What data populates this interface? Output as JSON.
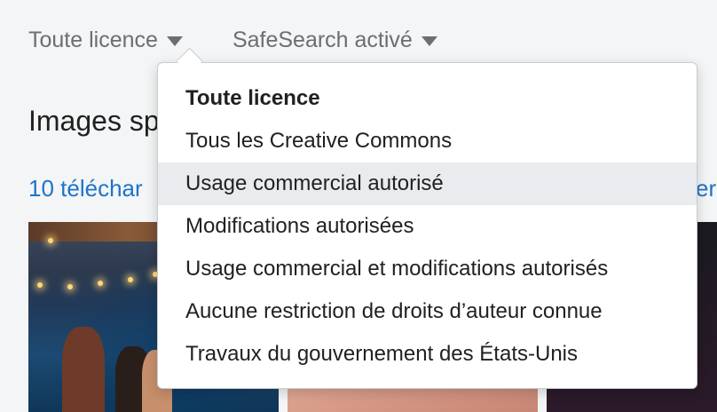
{
  "filters": {
    "license_label": "Toute licence",
    "safesearch_label": "SafeSearch activé"
  },
  "content": {
    "heading": "Images sp",
    "downloads_link": "10 téléchar",
    "right_link": "er"
  },
  "license_menu": {
    "items": [
      {
        "label": "Toute licence",
        "selected": true
      },
      {
        "label": "Tous les Creative Commons",
        "selected": false
      },
      {
        "label": "Usage commercial autorisé",
        "selected": false,
        "hovered": true
      },
      {
        "label": "Modifications autorisées",
        "selected": false
      },
      {
        "label": "Usage commercial et modifications autorisés",
        "selected": false
      },
      {
        "label": "Aucune restriction de droits d’auteur connue",
        "selected": false
      },
      {
        "label": "Travaux du gouvernement des États-Unis",
        "selected": false
      }
    ]
  },
  "colors": {
    "link": "#1d74c9",
    "hover_background": "#e9ebee",
    "page_background": "#f3f5f6"
  }
}
